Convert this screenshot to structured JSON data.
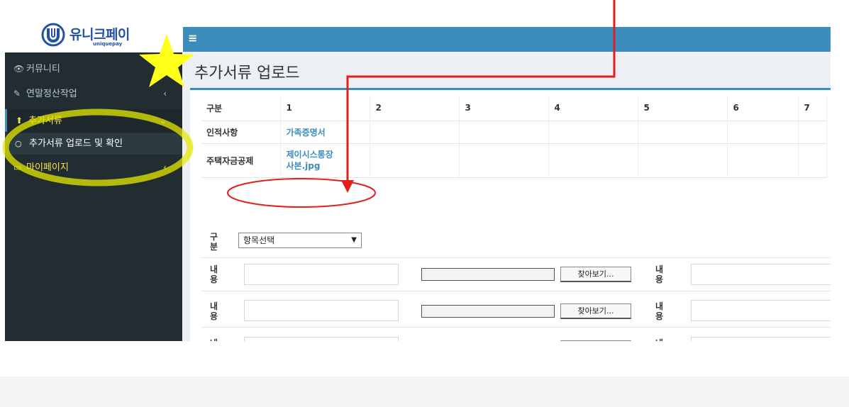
{
  "logo": {
    "name_kr": "유니크페이",
    "name_en": "uniquepay"
  },
  "topbar": {
    "menu_icon": "≡"
  },
  "sidebar": {
    "items": [
      {
        "label": "커뮤니티",
        "icon": "eye-icon"
      },
      {
        "label": "연말정산작업",
        "icon": "edit-icon"
      },
      {
        "label": "추가서류",
        "icon": "upload-icon"
      },
      {
        "label": "추가서류 업로드 및 확인",
        "icon": "circle-icon"
      },
      {
        "label": "마이페이지",
        "icon": "monitor-icon"
      }
    ]
  },
  "main": {
    "title": "추가서류 업로드",
    "table": {
      "header": [
        "구분",
        "1",
        "2",
        "3",
        "4",
        "5",
        "6",
        "7"
      ],
      "rows": [
        {
          "label": "인적사항",
          "cells": [
            "가족증명서",
            "",
            "",
            "",
            "",
            "",
            ""
          ]
        },
        {
          "label": "주택자금공제",
          "cells": [
            "제이시스통장\n사본.jpg",
            "",
            "",
            "",
            "",
            "",
            ""
          ]
        }
      ]
    },
    "form": {
      "category_label": "구\n분",
      "category_select": "항목선택",
      "content_label": "내\n용",
      "browse_label": "찾아보기..."
    }
  },
  "colors": {
    "accent": "#3c8dbc",
    "sidebar": "#222d32",
    "highlight": "#f6e44a",
    "annotation_red": "#e0201c",
    "annotation_yellow": "#ffff00"
  }
}
